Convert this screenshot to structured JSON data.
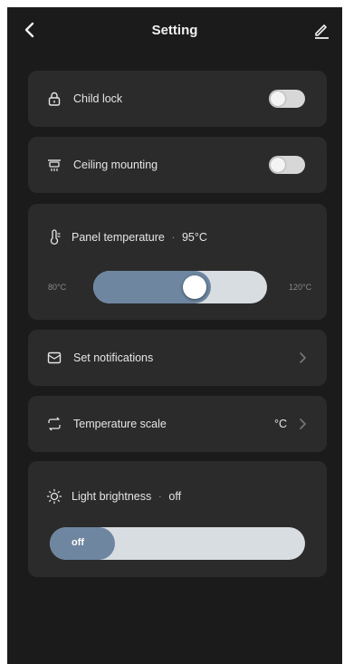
{
  "header": {
    "title": "Setting",
    "back_icon": "chevron-left-icon",
    "edit_icon": "pencil-icon"
  },
  "settings": {
    "child_lock": {
      "label": "Child lock",
      "icon": "lock-icon",
      "enabled": false
    },
    "ceiling_mounting": {
      "label": "Ceiling mounting",
      "icon": "ceiling-heater-icon",
      "enabled": false
    },
    "panel_temperature": {
      "label": "Panel temperature",
      "separator": "·",
      "value": "95°C",
      "icon": "thermometer-icon",
      "min_label": "80°C",
      "max_label": "120°C",
      "level": 0.6
    },
    "set_notifications": {
      "label": "Set notifications",
      "icon": "message-icon"
    },
    "temperature_scale": {
      "label": "Temperature scale",
      "icon": "swap-icon",
      "value": "°C"
    },
    "light_brightness": {
      "label": "Light brightness",
      "separator": "·",
      "value": "off",
      "icon": "sun-icon",
      "slider_label": "off",
      "level": 0.0
    }
  },
  "colors": {
    "background": "#1b1b1b",
    "card": "#2b2b2b",
    "slider_fill": "#6e86a0",
    "slider_track": "#d8dde2"
  }
}
